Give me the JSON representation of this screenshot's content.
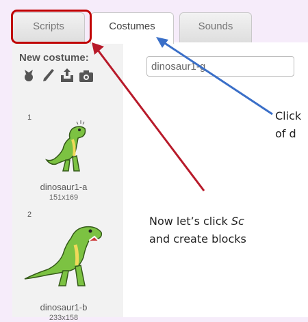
{
  "tabs": [
    {
      "label": "Scripts"
    },
    {
      "label": "Costumes"
    },
    {
      "label": "Sounds"
    }
  ],
  "left_panel": {
    "new_costume_label": "New costume:",
    "tools": [
      "choose-from-library-icon",
      "paint-brush-icon",
      "upload-icon",
      "camera-icon"
    ],
    "costumes": [
      {
        "number": "1",
        "name": "dinosaur1-a",
        "size": "151x169"
      },
      {
        "number": "2",
        "name": "dinosaur1-b",
        "size": "233x158"
      }
    ]
  },
  "editor": {
    "costume_name_value": "dinosaur1-g"
  },
  "annotations": {
    "note1_line1": "Click",
    "note1_line2": "of d",
    "note2_line1_prefix": "Now let’s click ",
    "note2_line1_italic": "Sc",
    "note2_line2": "and create blocks"
  },
  "colors": {
    "highlight_box": "#c00000",
    "red_arrow": "#b81a2a",
    "blue_arrow": "#3a6fc8",
    "dino_green": "#7cc242"
  }
}
